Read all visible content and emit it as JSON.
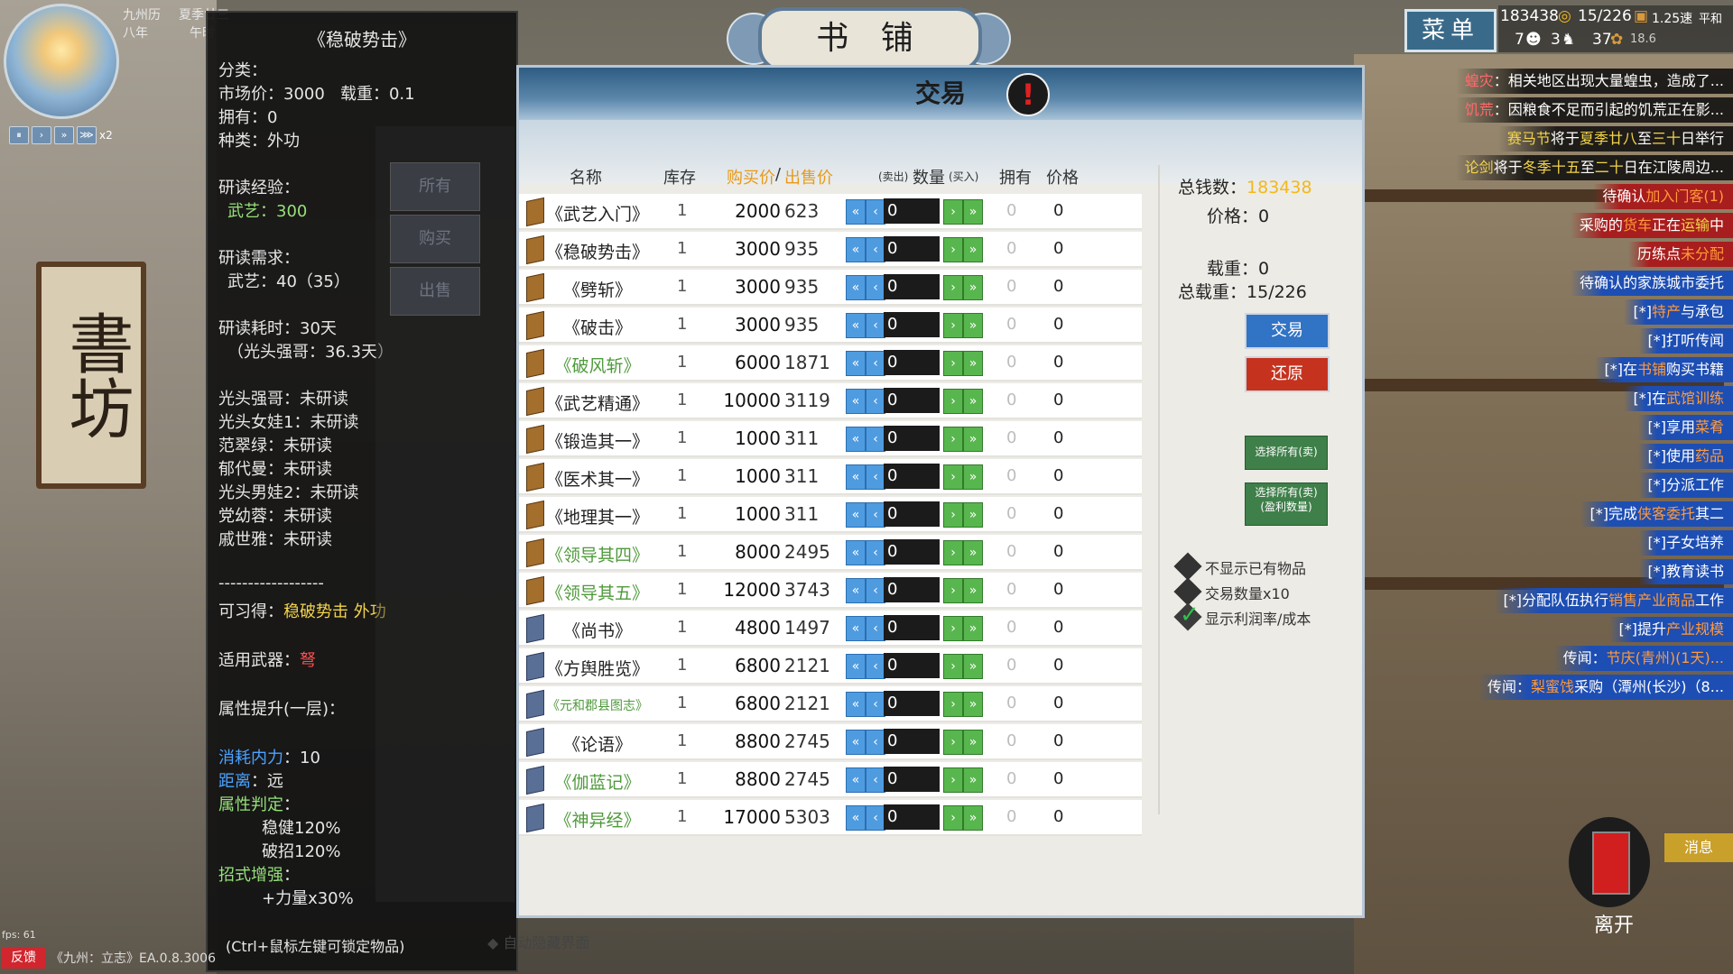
{
  "calendar": {
    "line1_a": "九州历",
    "line1_b": "夏季廿三",
    "line2_a": "八年",
    "line2_b": "午时"
  },
  "speed": {
    "pause": "⏸",
    "s1": "›",
    "s2": "»",
    "s3": "⋙",
    "mult": "x2"
  },
  "shop_title": "书 铺",
  "trade_header": "交易",
  "warn_mark": "!",
  "sign_text": "書坊",
  "tooltip": {
    "title": "《稳破势击》",
    "category_label": "分类：",
    "market_label": "市场价：",
    "market_value": "3000",
    "load_label": "载重：",
    "load_value": "0.1",
    "owned_label": "拥有：",
    "owned_value": "0",
    "kind_label": "种类：",
    "kind_value": "外功",
    "exp_label": "研读经验：",
    "exp_value": "武艺：300",
    "req_label": "研读需求：",
    "req_value": "武艺：40（35）",
    "time_label": "研读耗时：30天",
    "time_sub": "（光头强哥：36.3天）",
    "readers": [
      {
        "name": "光头强哥：",
        "status": "未研读"
      },
      {
        "name": "光头女娃1：",
        "status": "未研读"
      },
      {
        "name": "范翠绿：",
        "status": "未研读"
      },
      {
        "name": "郁代曼：",
        "status": "未研读"
      },
      {
        "name": "光头男娃2：",
        "status": "未研读"
      },
      {
        "name": "党幼蓉：",
        "status": "未研读"
      },
      {
        "name": "戚世雅：",
        "status": "未研读"
      }
    ],
    "divider": "------------------",
    "obtain_label": "可习得：",
    "obtain_value": "稳破势击 外功",
    "weapon_label": "适用武器：",
    "weapon_value": "弩",
    "attr_label": "属性提升(一层)：",
    "cost_label": "消耗内力",
    "cost_value": "：10",
    "range_label": "距离",
    "range_value": "：远",
    "judge_label": "属性判定",
    "judge_colon": "：",
    "judge1": "稳健120%",
    "judge2": "破招120%",
    "boost_label": "招式增强",
    "boost_colon": "：",
    "boost1": "+力量x30%"
  },
  "filters": [
    "所有",
    "购买",
    "出售"
  ],
  "table": {
    "headers": {
      "name": "名称",
      "stock": "库存",
      "buy": "购买价",
      "slash": "/",
      "sell": "出售价",
      "qty_small_l": "(卖出)",
      "qty": "数量",
      "qty_small_r": "(买入)",
      "own": "拥有",
      "price": "价格"
    },
    "rows": [
      {
        "name": "《武艺入门》",
        "stock": "1",
        "buy": "2000",
        "sell": "623",
        "qty": "0",
        "own": "0",
        "price": "0",
        "color": "normal",
        "book": "brown"
      },
      {
        "name": "《稳破势击》",
        "stock": "1",
        "buy": "3000",
        "sell": "935",
        "qty": "0",
        "own": "0",
        "price": "0",
        "color": "normal",
        "book": "brown"
      },
      {
        "name": "《劈斩》",
        "stock": "1",
        "buy": "3000",
        "sell": "935",
        "qty": "0",
        "own": "0",
        "price": "0",
        "color": "normal",
        "book": "brown"
      },
      {
        "name": "《破击》",
        "stock": "1",
        "buy": "3000",
        "sell": "935",
        "qty": "0",
        "own": "0",
        "price": "0",
        "color": "normal",
        "book": "brown"
      },
      {
        "name": "《破风斩》",
        "stock": "1",
        "buy": "6000",
        "sell": "1871",
        "qty": "0",
        "own": "0",
        "price": "0",
        "color": "green",
        "book": "brown"
      },
      {
        "name": "《武艺精通》",
        "stock": "1",
        "buy": "10000",
        "sell": "3119",
        "qty": "0",
        "own": "0",
        "price": "0",
        "color": "normal",
        "book": "brown"
      },
      {
        "name": "《锻造其一》",
        "stock": "1",
        "buy": "1000",
        "sell": "311",
        "qty": "0",
        "own": "0",
        "price": "0",
        "color": "normal",
        "book": "brown"
      },
      {
        "name": "《医术其一》",
        "stock": "1",
        "buy": "1000",
        "sell": "311",
        "qty": "0",
        "own": "0",
        "price": "0",
        "color": "normal",
        "book": "brown"
      },
      {
        "name": "《地理其一》",
        "stock": "1",
        "buy": "1000",
        "sell": "311",
        "qty": "0",
        "own": "0",
        "price": "0",
        "color": "normal",
        "book": "brown"
      },
      {
        "name": "《领导其四》",
        "stock": "1",
        "buy": "8000",
        "sell": "2495",
        "qty": "0",
        "own": "0",
        "price": "0",
        "color": "green",
        "book": "brown"
      },
      {
        "name": "《领导其五》",
        "stock": "1",
        "buy": "12000",
        "sell": "3743",
        "qty": "0",
        "own": "0",
        "price": "0",
        "color": "green",
        "book": "brown"
      },
      {
        "name": "《尚书》",
        "stock": "1",
        "buy": "4800",
        "sell": "1497",
        "qty": "0",
        "own": "0",
        "price": "0",
        "color": "normal",
        "book": "blue"
      },
      {
        "name": "《方舆胜览》",
        "stock": "1",
        "buy": "6800",
        "sell": "2121",
        "qty": "0",
        "own": "0",
        "price": "0",
        "color": "normal",
        "book": "blue"
      },
      {
        "name": "《元和郡县图志》",
        "stock": "1",
        "buy": "6800",
        "sell": "2121",
        "qty": "0",
        "own": "0",
        "price": "0",
        "color": "green-small",
        "book": "blue"
      },
      {
        "name": "《论语》",
        "stock": "1",
        "buy": "8800",
        "sell": "2745",
        "qty": "0",
        "own": "0",
        "price": "0",
        "color": "normal",
        "book": "blue"
      },
      {
        "name": "《伽蓝记》",
        "stock": "1",
        "buy": "8800",
        "sell": "2745",
        "qty": "0",
        "own": "0",
        "price": "0",
        "color": "green",
        "book": "blue"
      },
      {
        "name": "《神异经》",
        "stock": "1",
        "buy": "17000",
        "sell": "5303",
        "qty": "0",
        "own": "0",
        "price": "0",
        "color": "green",
        "book": "blue"
      }
    ]
  },
  "info": {
    "money_label": "总钱数：",
    "money_value": "183438",
    "price_label": "价格：",
    "price_value": "0",
    "load_label": "载重：",
    "load_value": "0",
    "total_load_label": "总载重：",
    "total_load_value": "15/226",
    "trade_btn": "交易",
    "reset_btn": "还原",
    "select_sell": "选择所有(卖)",
    "select_sell_profit_1": "选择所有(卖)",
    "select_sell_profit_2": "(盈利数量)",
    "check1": "不显示已有物品",
    "check2": "交易数量x10",
    "check3": "显示利润率/成本"
  },
  "hud": {
    "menu": "菜单",
    "money": "183438",
    "load": "15/226",
    "speed": "1.25速",
    "weather": "平和",
    "pop1": "7",
    "pop2": "3",
    "pop3": "37",
    "val4": "18.6"
  },
  "news": [
    {
      "a": "蝗灾",
      "b": "：相关地区出现大量蝗虫，造成了...",
      "style": "dark",
      "acolor": "cr"
    },
    {
      "a": "饥荒",
      "b": "：因粮食不足而引起的饥荒正在影...",
      "style": "dark",
      "acolor": "cr"
    },
    {
      "a": "赛马节",
      "b": "将于",
      "c": "夏季廿八",
      "d": "至",
      "e": "三十",
      "f": "日举行",
      "style": "dark",
      "acolor": "cy"
    },
    {
      "a": "论剑",
      "b": "将于",
      "c": "冬季十五",
      "d": "至",
      "e": "二十",
      "f": "日在江陵周边...",
      "style": "dark",
      "acolor": "cy"
    },
    {
      "a": "待确认",
      "b": "加入门客(1)",
      "style": "red"
    },
    {
      "a": "采购的",
      "b": "货车",
      "c": "正在",
      "d": "运输",
      "e": "中",
      "style": "red"
    },
    {
      "a": "历练点",
      "b": "未分配",
      "style": "red"
    },
    {
      "a": "待确认的家族城市委托",
      "style": "blue"
    },
    {
      "a": "[*]",
      "b": "特产",
      "c": "与",
      "d": "承包",
      "style": "blue"
    },
    {
      "a": "[*]打听传闻",
      "style": "blue"
    },
    {
      "a": "[*]在",
      "b": "书铺",
      "c": "购买书籍",
      "style": "blue"
    },
    {
      "a": "[*]在",
      "b": "武馆训练",
      "style": "blue"
    },
    {
      "a": "[*]享用",
      "b": "菜肴",
      "style": "blue"
    },
    {
      "a": "[*]使用",
      "b": "药品",
      "style": "blue"
    },
    {
      "a": "[*]分派工作",
      "style": "blue"
    },
    {
      "a": "[*]完成",
      "b": "侠客委托",
      "c": "其二",
      "style": "blue"
    },
    {
      "a": "[*]子女培养",
      "style": "blue"
    },
    {
      "a": "[*]教育读书",
      "style": "blue"
    },
    {
      "a": "[*]分配队伍执行",
      "b": "销售产业商品",
      "c": "工作",
      "style": "blue"
    },
    {
      "a": "[*]提升",
      "b": "产业规模",
      "style": "blue"
    },
    {
      "a": "传闻：",
      "b": "节庆(青州)(1天)...",
      "style": "blue"
    },
    {
      "a": "传闻：",
      "b": "梨蜜饯",
      "c": "采购（潭州(长沙)（8...",
      "style": "blue"
    }
  ],
  "bottom": {
    "leave": "离开",
    "msg": "消息",
    "fps": "fps: 61",
    "feedback": "反馈",
    "version": "《九州：立志》EA.0.8.3006",
    "hint": "(Ctrl+鼠标左键可锁定物品)",
    "autohide": "自动隐藏界面"
  },
  "colors": {
    "accent_blue": "#3173c5",
    "accent_red": "#c5331f",
    "green_text": "#4f9a3c",
    "money_yellow": "#f2b81c"
  }
}
